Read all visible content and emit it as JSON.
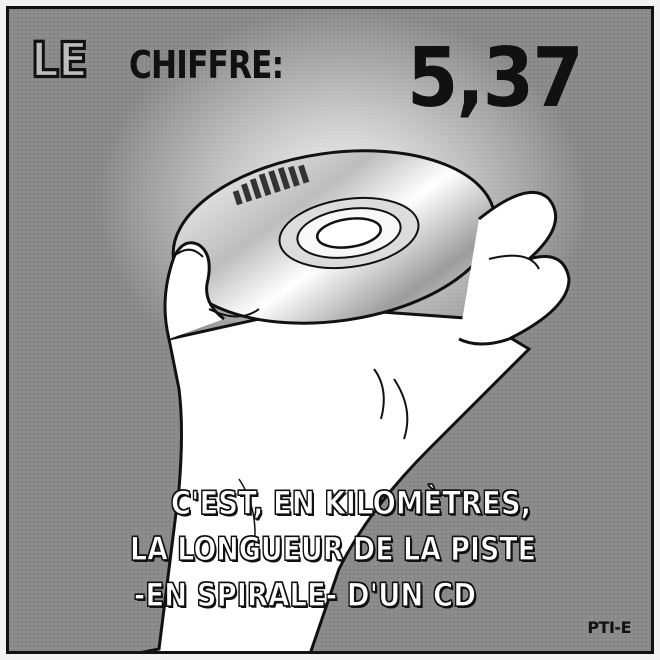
{
  "header": {
    "prefix": "LE",
    "label": "CHIFFRE:",
    "number": "5,37"
  },
  "illustration": {
    "subject_icon": "hand-holding-cd-icon"
  },
  "caption": {
    "line1": "C'EST, EN KILOMÈTRES,",
    "line2": "LA LONGUEUR DE LA PISTE",
    "line3": "-EN SPIRALE- D'UN CD"
  },
  "credit": "PTI-E",
  "colors": {
    "background": "#8f8f8f",
    "ink": "#111111",
    "caption_fill": "#ffffff"
  }
}
